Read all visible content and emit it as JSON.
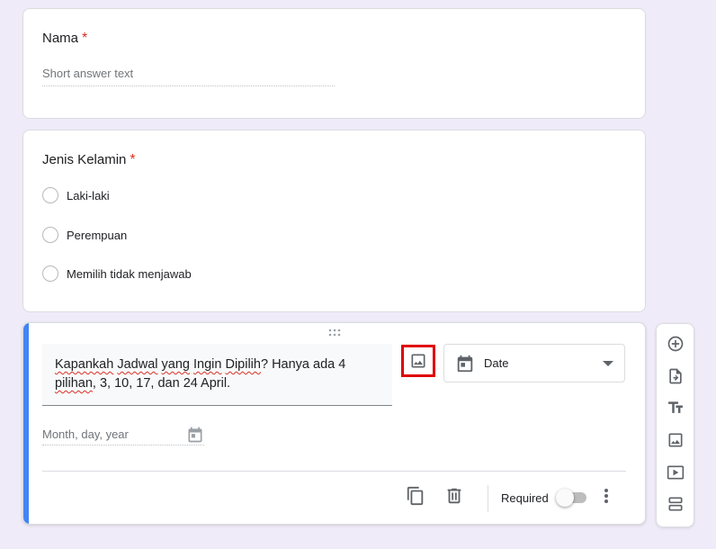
{
  "questions": {
    "nama": {
      "title": "Nama",
      "required_mark": "*",
      "placeholder": "Short answer text"
    },
    "gender": {
      "title": "Jenis Kelamin",
      "required_mark": "*",
      "options": [
        "Laki-laki",
        "Perempuan",
        "Memilih tidak menjawab"
      ]
    },
    "date_question": {
      "title_words": {
        "w1": "Kapankah",
        "w2": "Jadwal",
        "w3": "yang",
        "w4": "Ingin",
        "w5": "Dipilih",
        "w6": "? Hanya ada 4",
        "w7": "pilihan",
        "w8": ", 3, 10, 17, dan 24 April."
      },
      "type_label": "Date",
      "date_placeholder": "Month, day, year",
      "required_label": "Required",
      "required_on": false
    }
  },
  "icons": {
    "add_image": "image-icon",
    "type": "calendar-icon",
    "dropdown": "dropdown-arrow-icon",
    "duplicate": "copy-icon",
    "delete": "trash-icon",
    "more": "more-vert-icon",
    "toolbar": [
      "add-circle-icon",
      "import-icon",
      "title-text-icon",
      "image-icon",
      "video-icon",
      "section-icon"
    ]
  },
  "colors": {
    "background": "#f0ebf8",
    "accent": "#4285f4",
    "required": "#d93025",
    "highlight_box": "#e00000"
  }
}
